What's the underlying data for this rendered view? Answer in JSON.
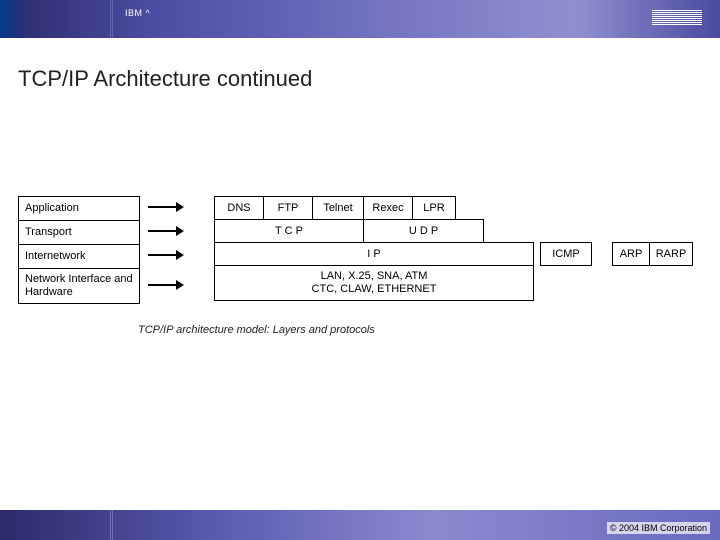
{
  "header": {
    "brand_label": "IBM ^"
  },
  "title": "TCP/IP Architecture continued",
  "layers": {
    "l1": "Application",
    "l2": "Transport",
    "l3": "Internetwork",
    "l4": "Network Interface and Hardware"
  },
  "protocols": {
    "dns": "DNS",
    "ftp": "FTP",
    "telnet": "Telnet",
    "rexec": "Rexec",
    "lpr": "LPR",
    "tcp": "T C P",
    "udp": "U D P",
    "ip": "I P",
    "icmp": "ICMP",
    "arp": "ARP",
    "rarp": "RARP",
    "net": "LAN, X.25, SNA, ATM\nCTC, CLAW, ETHERNET"
  },
  "caption": "TCP/IP architecture model: Layers and protocols",
  "footer": {
    "copyright": "© 2004 IBM Corporation"
  }
}
